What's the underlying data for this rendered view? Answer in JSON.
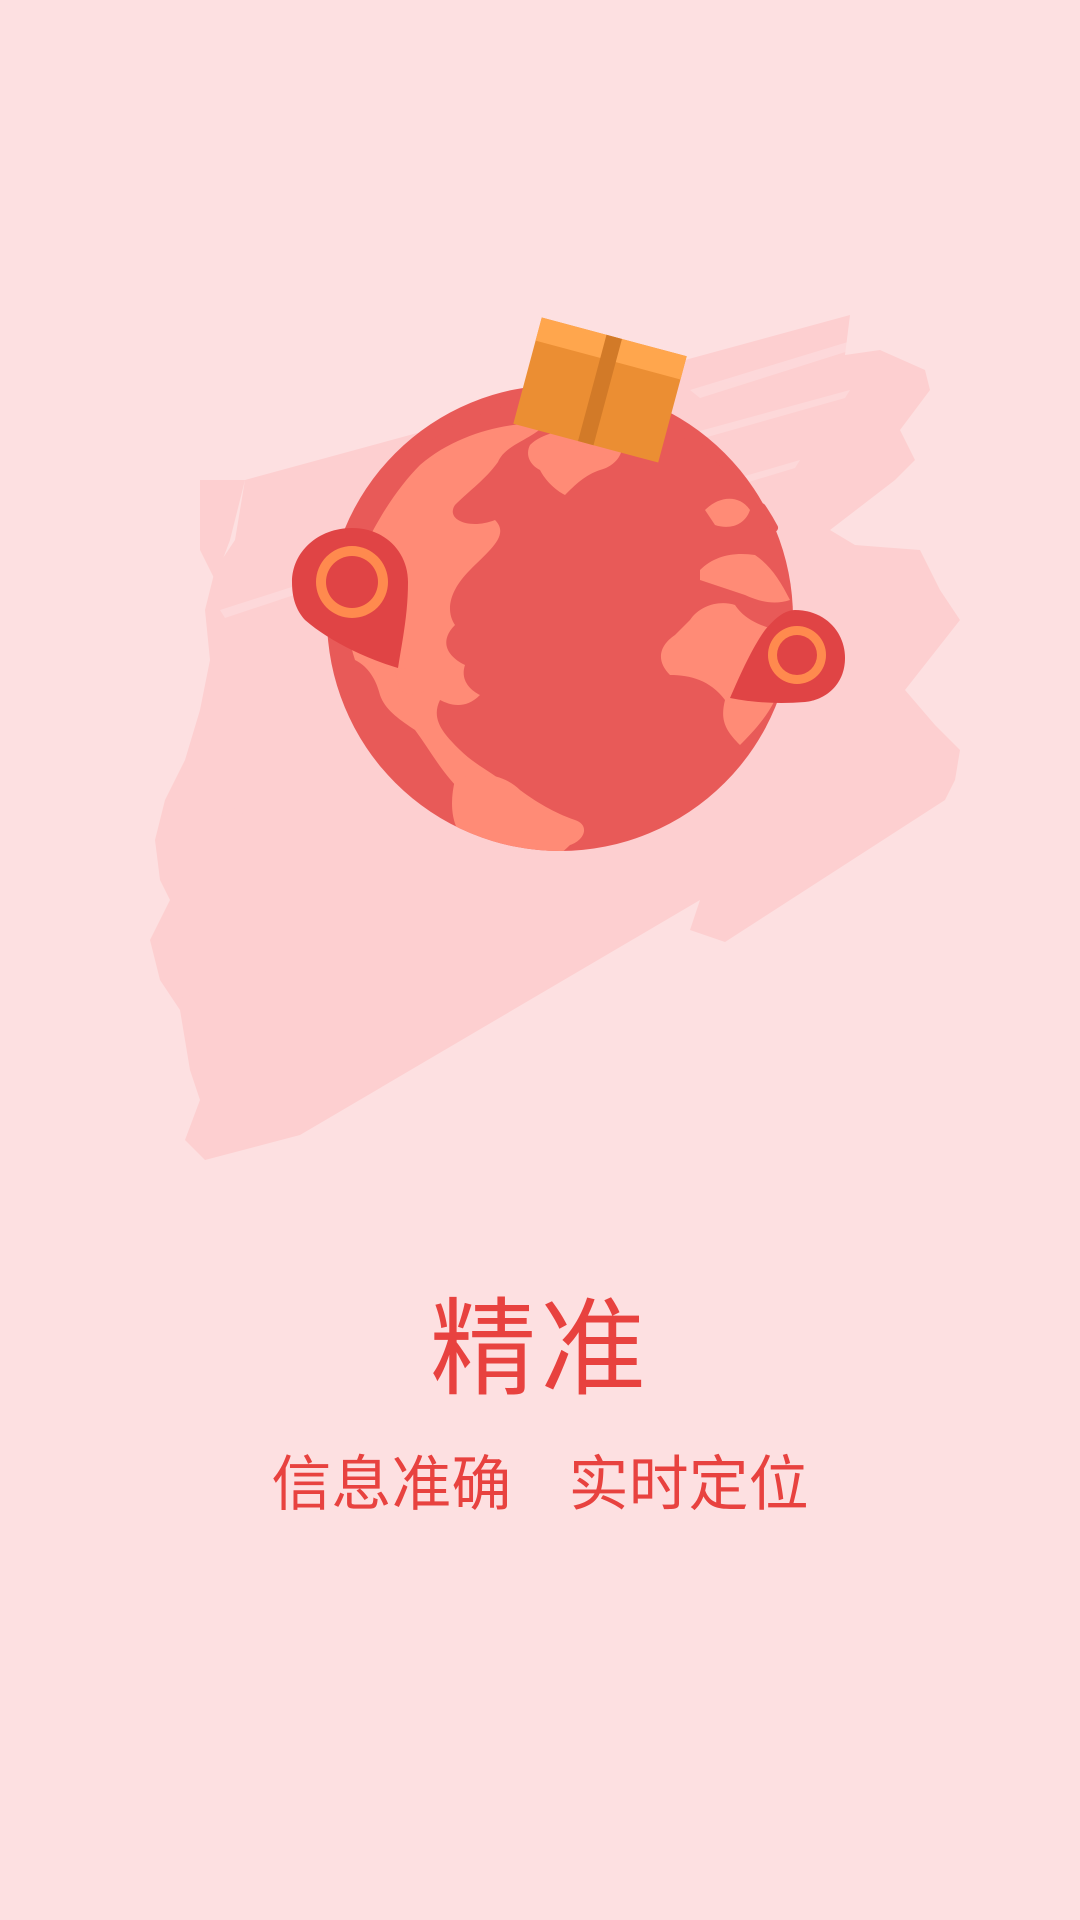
{
  "onboarding": {
    "title": "精准",
    "subtitle": "信息准确   实时定位"
  },
  "colors": {
    "background": "#fde0e1",
    "brush": "#fdcfd0",
    "globe_ocean": "#e85a58",
    "globe_land": "#ff8b76",
    "pin": "#e04445",
    "pin_ring": "#ff8a4e",
    "box": "#eb8e33",
    "box_top": "#ffa64d",
    "box_tape": "#d27a28",
    "text": "#e8423f"
  },
  "icons": [
    "globe-icon",
    "location-pin-icon",
    "package-box-icon",
    "brush-stroke-background"
  ]
}
